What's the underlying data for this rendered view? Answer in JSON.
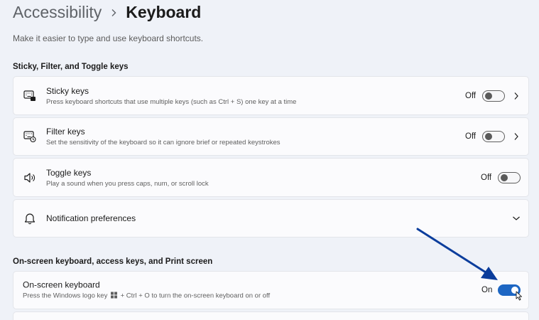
{
  "breadcrumb": {
    "parent": "Accessibility",
    "current": "Keyboard"
  },
  "subtitle": "Make it easier to type and use keyboard shortcuts.",
  "sections": [
    {
      "heading": "Sticky, Filter, and Toggle keys"
    },
    {
      "heading": "On-screen keyboard, access keys, and Print screen"
    }
  ],
  "settings": {
    "sticky_keys": {
      "title": "Sticky keys",
      "description": "Press keyboard shortcuts that use multiple keys (such as Ctrl + S) one key at a time",
      "state": "Off",
      "icon": "sticky-keys-icon"
    },
    "filter_keys": {
      "title": "Filter keys",
      "description": "Set the sensitivity of the keyboard so it can ignore brief or repeated keystrokes",
      "state": "Off",
      "icon": "filter-keys-icon"
    },
    "toggle_keys": {
      "title": "Toggle keys",
      "description": "Play a sound when you press caps, num, or scroll lock",
      "state": "Off",
      "icon": "speaker-icon"
    },
    "notification_preferences": {
      "title": "Notification preferences",
      "icon": "bell-icon"
    },
    "onscreen_keyboard": {
      "title": "On-screen keyboard",
      "description_before": "Press the Windows logo key",
      "description_after": "+ Ctrl + O to turn the on-screen keyboard on or off",
      "state": "On",
      "icon": "windows-logo-icon"
    }
  },
  "colors": {
    "accent": "#1d66c3",
    "annotation_arrow": "#0b3d9c",
    "background": "#eff2f8",
    "card": "#fbfbfd"
  }
}
